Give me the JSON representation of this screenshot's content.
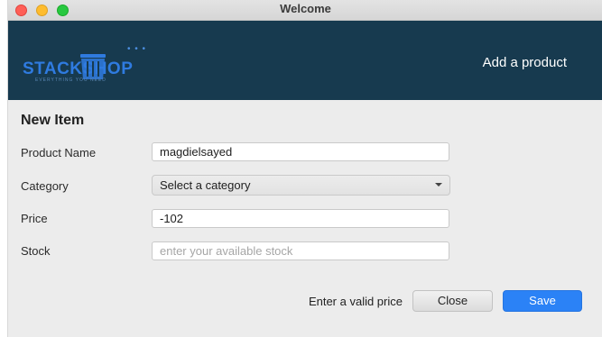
{
  "window": {
    "title": "Welcome"
  },
  "header": {
    "logo_text": "STACKSHOP",
    "logo_tagline": "EVERYTHING YOU NEED",
    "logo_dots": "• • •",
    "title": "Add a product"
  },
  "form": {
    "title": "New Item",
    "product_name": {
      "label": "Product Name",
      "value": "magdielsayed"
    },
    "category": {
      "label": "Category",
      "selected": "Select a category"
    },
    "price": {
      "label": "Price",
      "value": "-102"
    },
    "stock": {
      "label": "Stock",
      "value": "",
      "placeholder": "enter your available stock"
    }
  },
  "footer": {
    "error_message": "Enter a valid price",
    "close_label": "Close",
    "save_label": "Save"
  },
  "colors": {
    "header_bg": "#173a4f",
    "logo_blue": "#2f7be0",
    "save_button": "#2b82f6"
  }
}
